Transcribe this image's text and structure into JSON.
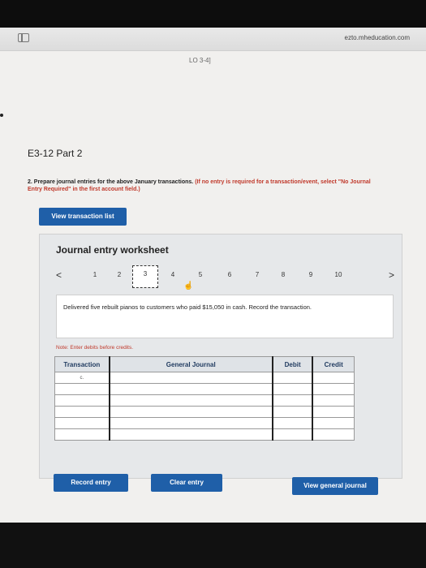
{
  "browser": {
    "url": "ezto.mheducation.com"
  },
  "page": {
    "lo_tag": "LO 3-4]",
    "title": "E3-12 Part 2",
    "instruction_main": "2. Prepare journal entries for the above January transactions.",
    "instruction_note": "(If no entry is required for a transaction/event, select \"No Journal Entry Required\" in the first account field.)",
    "view_transaction_label": "View transaction list"
  },
  "worksheet": {
    "title": "Journal entry worksheet",
    "prev_arrow": "<",
    "next_arrow": ">",
    "pages": [
      "1",
      "2",
      "3",
      "4",
      "5",
      "6",
      "7",
      "8",
      "9",
      "10"
    ],
    "active_page": "3",
    "description": "Delivered five rebuilt pianos to customers who paid $15,050 in cash. Record the transaction.",
    "note": "Note: Enter debits before credits.",
    "table": {
      "headers": [
        "Transaction",
        "General Journal",
        "Debit",
        "Credit"
      ],
      "rows": [
        {
          "transaction": "c.",
          "account": "",
          "debit": "",
          "credit": ""
        },
        {
          "transaction": "",
          "account": "",
          "debit": "",
          "credit": ""
        },
        {
          "transaction": "",
          "account": "",
          "debit": "",
          "credit": ""
        },
        {
          "transaction": "",
          "account": "",
          "debit": "",
          "credit": ""
        },
        {
          "transaction": "",
          "account": "",
          "debit": "",
          "credit": ""
        },
        {
          "transaction": "",
          "account": "",
          "debit": "",
          "credit": ""
        }
      ]
    },
    "record_entry_label": "Record entry",
    "clear_entry_label": "Clear entry",
    "view_general_journal_label": "View general journal"
  },
  "colors": {
    "button_blue": "#1f5fa8",
    "note_red": "#c0392b",
    "panel_bg": "#e6e8ea"
  }
}
